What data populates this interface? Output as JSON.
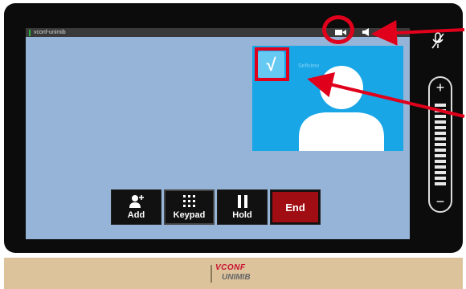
{
  "window": {
    "title": "vconf-unimib"
  },
  "selfview": {
    "label": "Selfview",
    "badge": "√"
  },
  "call_controls": {
    "add_label": "Add",
    "keypad_label": "Keypad",
    "hold_label": "Hold",
    "end_label": "End"
  },
  "volume": {
    "plus": "+",
    "minus": "−"
  },
  "logo": {
    "line1": "VCONF",
    "line2": "UNIMIB"
  },
  "colors": {
    "end": "#a00e14",
    "selfview": "#18a6e6",
    "screen": "#96b4d7",
    "annotation": "#e0001b"
  },
  "icons": [
    "camera-icon",
    "speaker-icon",
    "mic-muted-icon",
    "add-contact-icon",
    "keypad-icon",
    "pause-icon",
    "selfview-person-icon"
  ]
}
